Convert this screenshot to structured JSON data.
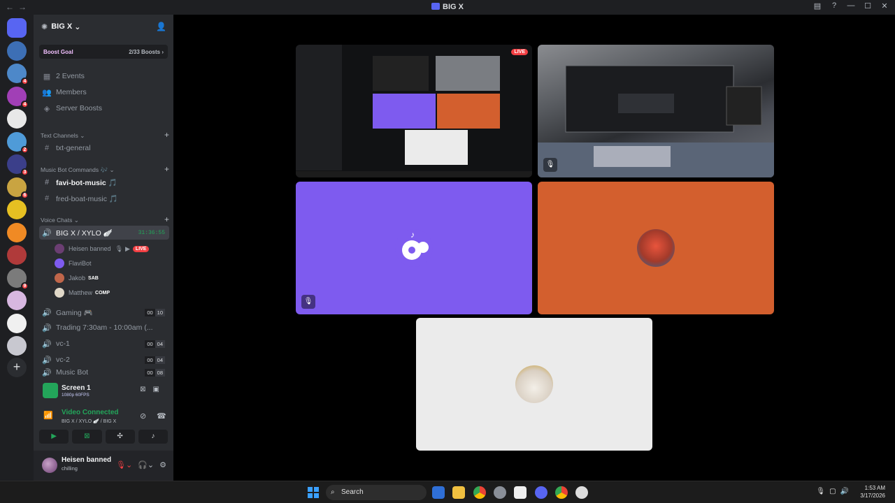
{
  "window": {
    "title": "BIG X"
  },
  "guild": {
    "name": "BIG X",
    "boost_label": "Boost Goal",
    "boost_count": "2/33 Boosts"
  },
  "nav": {
    "events": "2 Events",
    "members": "Members",
    "boosts": "Server Boosts"
  },
  "categories": {
    "text": "Text Channels",
    "music": "Music Bot Commands 🎶",
    "voice": "Voice Chats"
  },
  "channels": {
    "txt_general": "txt-general",
    "favi": "favi-bot-music 🎵",
    "fred": "fred-boat-music 🎵",
    "bigx_voice": "BIG X / XYLO 🪽",
    "bigx_timer": "31:36:55",
    "gaming": "Gaming 🎮",
    "trading": "Trading 7:30am - 10:00am (...",
    "vc1": "vc-1",
    "vc2": "vc-2",
    "music_bot": "Music Bot"
  },
  "voice_users": [
    {
      "name": "Heisen banned",
      "badge": "LIVE"
    },
    {
      "name": "FlaviBot",
      "badge": ""
    },
    {
      "name": "Jakob",
      "badge": "SAB"
    },
    {
      "name": "Matthew",
      "badge": "COMP"
    }
  ],
  "counts": {
    "gaming": [
      "00",
      "10"
    ],
    "vc1": [
      "00",
      "04"
    ],
    "vc2": [
      "00",
      "04"
    ],
    "music_bot": [
      "00",
      "08"
    ]
  },
  "screen": {
    "title": "Screen 1",
    "quality": "1080p 60FPS"
  },
  "connection": {
    "status": "Video Connected",
    "channel": "BIG X / XYLO 🪽 / BIG X"
  },
  "user": {
    "name": "Heisen banned",
    "status": "chilling"
  },
  "stage": {
    "live": "LIVE"
  },
  "taskbar": {
    "search": "Search",
    "time": "1:53 AM",
    "date": "3/17/2026"
  },
  "servers": [
    {
      "color": "#5865f2",
      "badge": ""
    },
    {
      "color": "#3d6fb5",
      "badge": ""
    },
    {
      "color": "#4d88c9",
      "badge": "4"
    },
    {
      "color": "#a13fb6",
      "badge": "4"
    },
    {
      "color": "#e8e8e8",
      "badge": ""
    },
    {
      "color": "#4f9bd8",
      "badge": "2"
    },
    {
      "color": "#3b3f8a",
      "badge": "3"
    },
    {
      "color": "#c9a441",
      "badge": "6"
    },
    {
      "color": "#e6c022",
      "badge": ""
    },
    {
      "color": "#f08a24",
      "badge": ""
    },
    {
      "color": "#b03a3a",
      "badge": ""
    },
    {
      "color": "#7b7b7b",
      "badge": "9"
    },
    {
      "color": "#d7b7e0",
      "badge": ""
    },
    {
      "color": "#f0f0f0",
      "badge": ""
    },
    {
      "color": "#c8c8d0",
      "badge": ""
    }
  ]
}
